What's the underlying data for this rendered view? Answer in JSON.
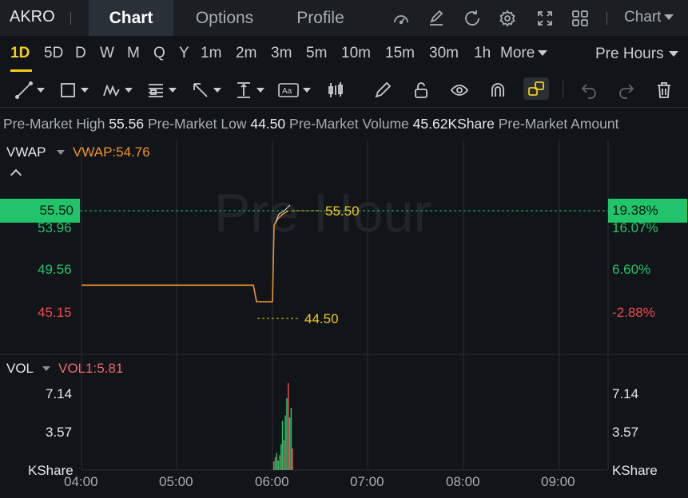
{
  "topnav": {
    "ticker": "AKRO",
    "tabs": [
      {
        "label": "Chart",
        "active": true
      },
      {
        "label": "Options",
        "active": false
      },
      {
        "label": "Profile",
        "active": false
      }
    ],
    "icons": [
      "gauge-icon",
      "edit-icon",
      "refresh-icon",
      "settings-icon",
      "fullscreen-icon",
      "grid-icon"
    ],
    "chart_selector": "Chart"
  },
  "timeframes": {
    "items": [
      "1D",
      "5D",
      "D",
      "W",
      "M",
      "Q",
      "Y",
      "1m",
      "2m",
      "3m",
      "5m",
      "10m",
      "15m",
      "30m",
      "1h",
      "More"
    ],
    "active": "1D",
    "session": "Pre Hours"
  },
  "toolbar": {
    "tools": [
      "trendline-tool",
      "rectangle-tool",
      "pattern-tool",
      "fib-tool",
      "arrow-tool",
      "measure-tool",
      "text-tool",
      "candle-tool",
      "pencil-tool",
      "lock-icon",
      "eye-icon",
      "magnet-icon",
      "layout-icon",
      "undo-icon",
      "redo-icon",
      "trash-icon"
    ]
  },
  "info": {
    "high_label": "Pre-Market High",
    "high": "55.56",
    "low_label": "Pre-Market Low",
    "low": "44.50",
    "volume_label": "Pre-Market Volume",
    "volume": "45.62KShare",
    "amount_label": "Pre-Market Amount"
  },
  "price_panel": {
    "indicator": "VWAP",
    "indicator_value": "VWAP:54.76",
    "current_price": "55.50",
    "current_pct": "19.38%",
    "high_marker": "55.50",
    "low_marker": "44.50",
    "left_axis": [
      "53.96",
      "49.56",
      "45.15"
    ],
    "right_axis": [
      "16.07%",
      "6.60%",
      "-2.88%"
    ],
    "watermark": "Pre Hour",
    "colors": {
      "up": "#21c46b",
      "down": "#ef4a4a",
      "vwap": "#f0952a",
      "marker": "#f2cd1a"
    }
  },
  "volume_panel": {
    "indicator": "VOL",
    "indicator_value": "VOL1:5.81",
    "left_axis": [
      "7.14",
      "3.57",
      "KShare"
    ],
    "right_axis": [
      "7.14",
      "3.57",
      "KShare"
    ]
  },
  "time_axis": [
    "04:00",
    "05:00",
    "06:00",
    "07:00",
    "08:00",
    "09:00"
  ],
  "chart_data": {
    "type": "line",
    "price_series": [
      {
        "t": "04:00",
        "v": 47.9
      },
      {
        "t": "05:00",
        "v": 47.9
      },
      {
        "t": "05:48",
        "v": 47.9
      },
      {
        "t": "05:50",
        "v": 46.2
      },
      {
        "t": "06:00",
        "v": 46.2
      },
      {
        "t": "06:01",
        "v": 54.0
      },
      {
        "t": "06:03",
        "v": 54.6
      },
      {
        "t": "06:06",
        "v": 55.1
      },
      {
        "t": "06:10",
        "v": 55.5
      }
    ],
    "volume_bars": [
      0.8,
      1.2,
      1.6,
      0.9,
      1.4,
      2.4,
      4.6,
      2.8,
      5.1,
      6.7,
      8.1,
      4.9,
      5.8,
      2.0
    ]
  }
}
